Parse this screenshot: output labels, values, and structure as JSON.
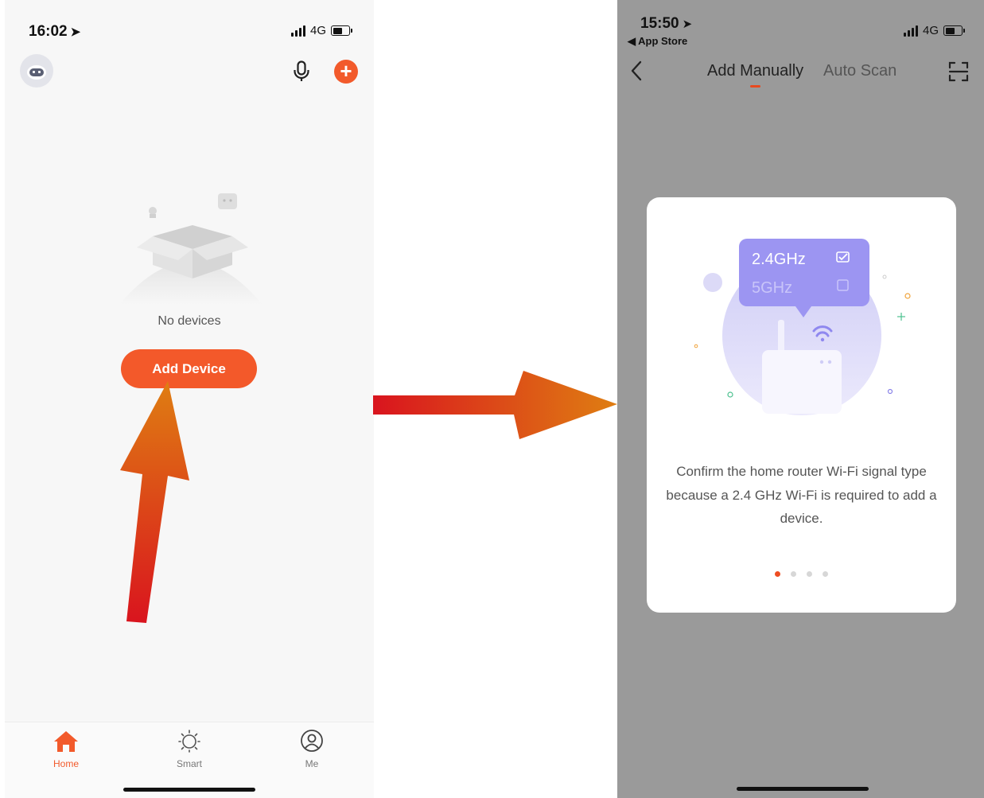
{
  "left_screen": {
    "status": {
      "time": "16:02",
      "network": "4G"
    },
    "empty_state": {
      "message": "No devices"
    },
    "add_device_label": "Add Device",
    "tabs": [
      {
        "label": "Home",
        "icon": "home-icon",
        "active": true
      },
      {
        "label": "Smart",
        "icon": "sun-icon",
        "active": false
      },
      {
        "label": "Me",
        "icon": "profile-icon",
        "active": false
      }
    ]
  },
  "right_screen": {
    "status": {
      "time": "15:50",
      "network": "4G",
      "back_app": "◀ App Store"
    },
    "tabs": [
      {
        "label": "Add Manually",
        "active": true
      },
      {
        "label": "Auto Scan",
        "active": false
      }
    ],
    "modal": {
      "band_options": [
        {
          "label": "2.4GHz",
          "checked": true
        },
        {
          "label": "5GHz",
          "checked": false
        }
      ],
      "description": "Confirm the home router Wi-Fi signal type because a 2.4 GHz Wi-Fi is required to add a device.",
      "page_indicator": {
        "pages": 4,
        "current": 1
      }
    }
  },
  "colors": {
    "accent": "#f25a2b",
    "modal_purple": "#9c95f2",
    "overlay_gray": "#9a9a9a",
    "arrow_start": "#d9141e",
    "arrow_end": "#df7e12"
  }
}
